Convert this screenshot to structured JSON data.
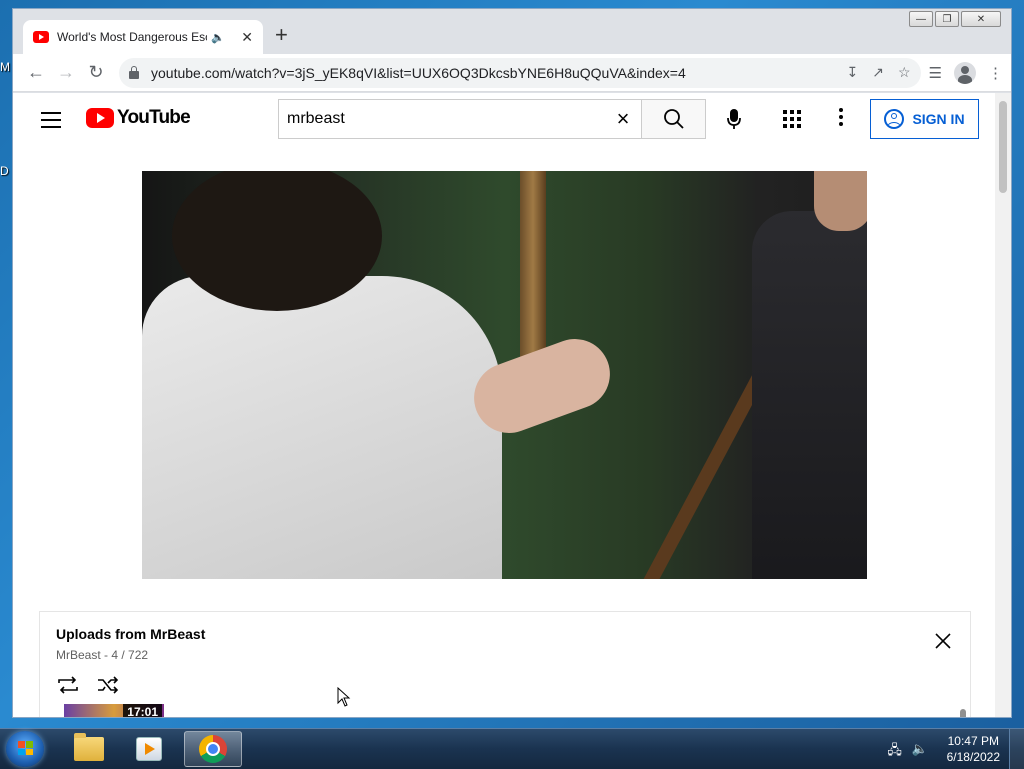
{
  "desktop": {
    "label_1": "M",
    "label_2": "D"
  },
  "browser": {
    "tab_title": "World's Most Dangerous Esc",
    "new_tab_label": "+",
    "url": "youtube.com/watch?v=3jS_yEK8qVI&list=UUX6OQ3DkcsbYNE6H8uQQuVA&index=4",
    "icons": [
      "back-icon",
      "forward-icon",
      "reload-icon",
      "lock-icon",
      "install-icon",
      "share-icon",
      "star-icon",
      "media-control-icon",
      "profile-icon",
      "menu-icon"
    ]
  },
  "youtube": {
    "logo_text": "YouTube",
    "search_value": "mrbeast",
    "signin_label": "SIGN IN"
  },
  "playlist": {
    "title": "Uploads from MrBeast",
    "channel": "MrBeast",
    "separator": " - ",
    "position": "4 / 722",
    "thumb_duration": "17:01"
  },
  "taskbar": {
    "time": "10:47 PM",
    "date": "6/18/2022",
    "items": [
      "windows-explorer",
      "media-player",
      "google-chrome"
    ]
  }
}
